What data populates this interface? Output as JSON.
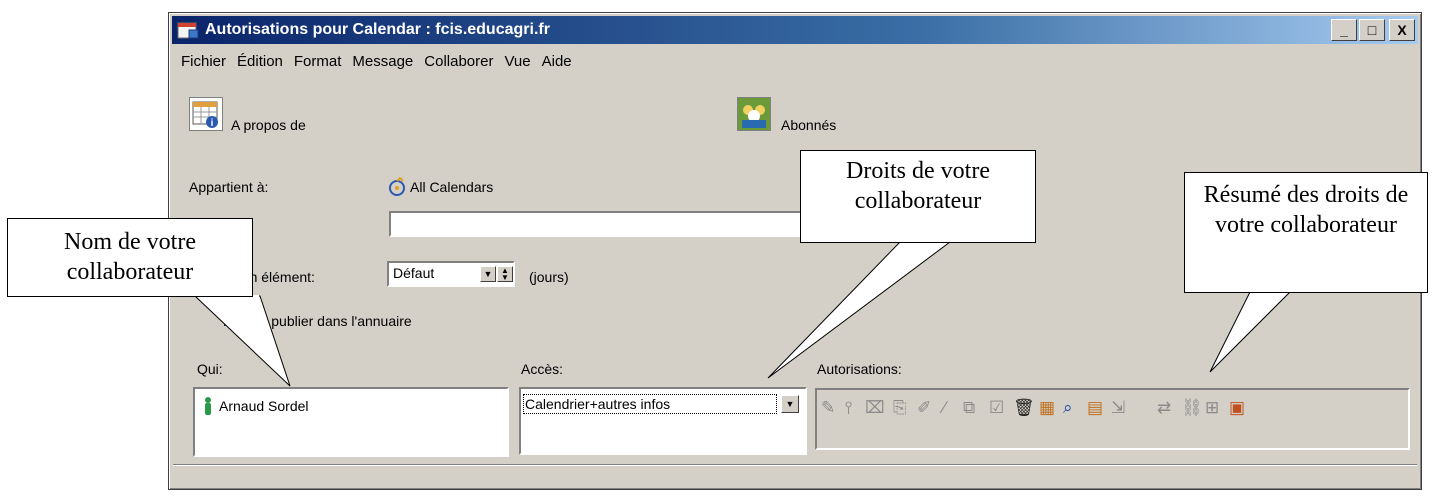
{
  "window": {
    "title": "Autorisations pour Calendar : fcis.educagri.fr",
    "controls": {
      "minimize": "_",
      "maximize": "□",
      "close": "X"
    }
  },
  "menu": [
    "Fichier",
    "Édition",
    "Format",
    "Message",
    "Collaborer",
    "Vue",
    "Aide"
  ],
  "sections": {
    "about": "A propos de",
    "subscribers": "Abonnés"
  },
  "form": {
    "owner_label": "Appartient à:",
    "owner_value": "All Calendars",
    "text_field_value": "",
    "duration_label": "ation élément:",
    "duration_value": "Défaut",
    "duration_unit": "(jours)",
    "no_publish": "Ne pas publier dans l'annuaire"
  },
  "perms": {
    "who_label": "Qui:",
    "access_label": "Accès:",
    "rights_label": "Autorisations:",
    "user": "Arnaud Sordel",
    "access_value": "Calendrier+autres infos"
  },
  "callouts": {
    "name": "Nom de votre collaborateur",
    "rights": "Droits de votre collaborateur",
    "summary": "Résumé des droits de votre collaborateur"
  },
  "icons": {
    "rights_toolbar": [
      "pen-icon",
      "pin-icon",
      "trash-icon",
      "copy-icon",
      "edit-icon",
      "pencil-icon",
      "duplicate-icon",
      "check-icon",
      "delete-icon",
      "calendar-icon",
      "search-icon",
      "calendar-info-icon",
      "move-icon",
      "convert-icon",
      "link-icon",
      "tree-icon",
      "calendar-share-icon"
    ]
  }
}
